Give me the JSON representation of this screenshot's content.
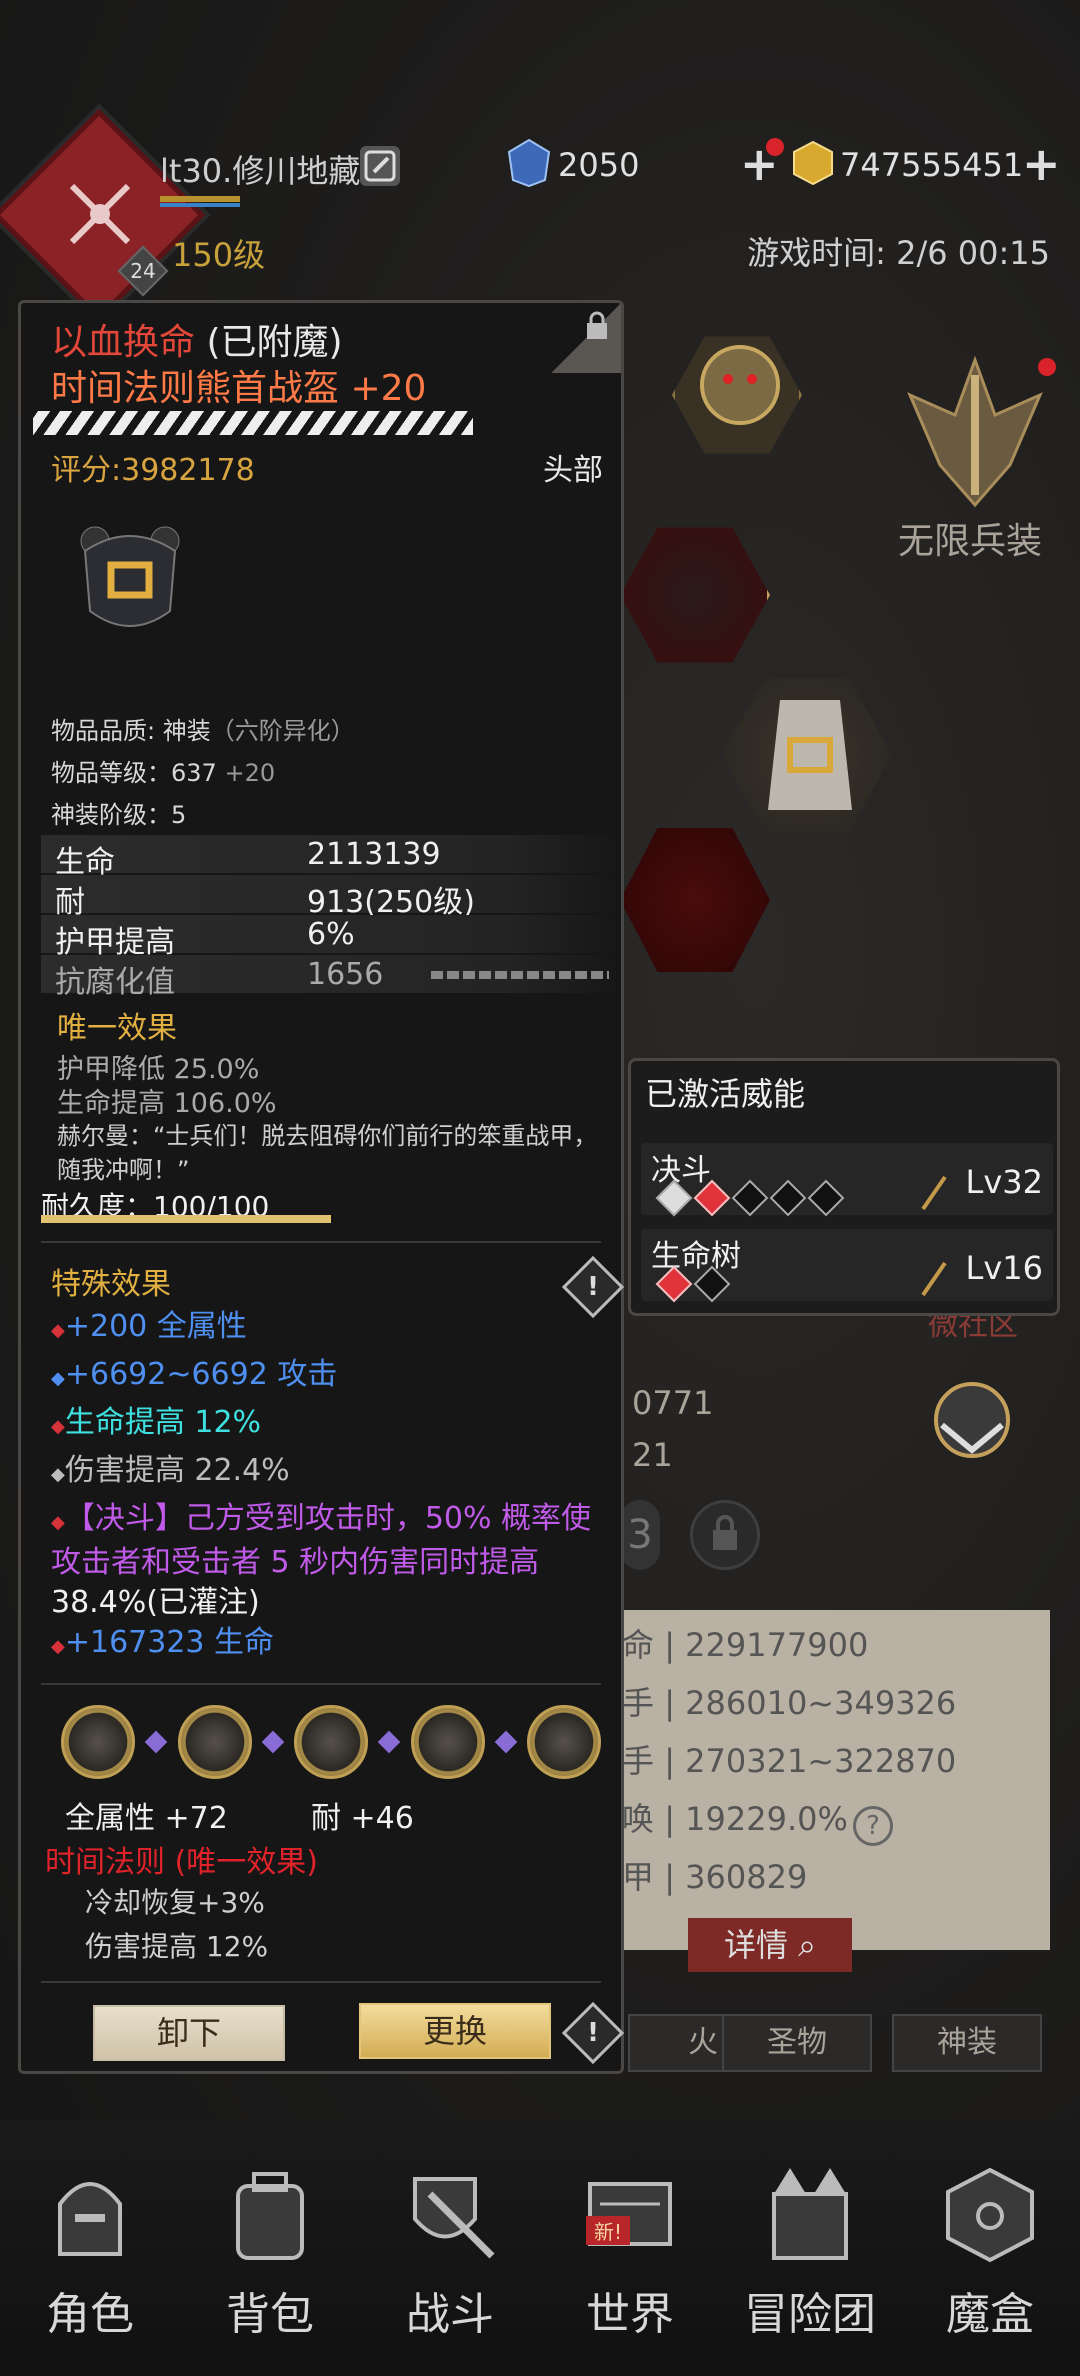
{
  "header": {
    "player_name": "lt30.修川地藏",
    "level": "150级",
    "badge": "24",
    "currency_blue": "2050",
    "currency_gold": "747555451",
    "game_time": "游戏时间: 2/6 00:15"
  },
  "item": {
    "name_prefix": "以血换命",
    "enchanted": " (已附魔)",
    "name": "时间法则熊首战盔 +20",
    "score": "评分:3982178",
    "slot": "头部",
    "quality_label": "物品品质: 神装",
    "quality_sub": "（六阶异化）",
    "item_level_label": "物品等级：637",
    "item_level_bonus": "+20",
    "divine_tier": "神装阶级：5",
    "stats": [
      {
        "name": "生命",
        "value": "2113139"
      },
      {
        "name": "耐",
        "value": "913(250级)"
      },
      {
        "name": "护甲提高",
        "value": "6%"
      },
      {
        "name": "抗腐化值",
        "value": "1656"
      }
    ],
    "unique_title": "唯一效果",
    "unique_lines": [
      "护甲降低 25.0%",
      "生命提高 106.0%"
    ],
    "quote": "赫尔曼：“士兵们！脱去阻碍你们前行的笨重战甲，随我冲啊！”",
    "durability_label": "耐久度：",
    "durability_value": "100/100",
    "durability_fraction": 1.0,
    "special_title": "特殊效果",
    "effects": [
      {
        "text": "+200 全属性",
        "color": "#4f8ff0"
      },
      {
        "text": "+6692~6692 攻击",
        "color": "#4f8ff0"
      },
      {
        "text": "生命提高 12%",
        "color": "#3fe0e0"
      },
      {
        "text": "伤害提高 22.4%",
        "color": "#bdbdbd"
      }
    ],
    "duel_effect_a": "【决斗】己方受到攻击时，50% 概率使攻击者和受击者 5 秒内伤害同时提高",
    "duel_effect_b": " 38.4%(已灌注)",
    "life_bonus": "+167323 生命",
    "socket_stat_1": "全属性  +72",
    "socket_stat_2": "耐  +46",
    "set_title": "时间法则 (唯一效果)",
    "set_lines": [
      "冷却恢复+3%",
      "伤害提高 12%"
    ],
    "btn_unequip": "卸下",
    "btn_replace": "更换"
  },
  "right": {
    "infinite_arms": "无限兵装",
    "weineng_title": "已激活威能",
    "weineng": [
      {
        "name": "决斗",
        "level": "Lv32"
      },
      {
        "name": "生命树",
        "level": "Lv16"
      }
    ],
    "partial_1": "0771",
    "partial_2": "21",
    "partial_3": "3",
    "stats": [
      {
        "k": "命",
        "v": "229177900"
      },
      {
        "k": "手",
        "v": "286010~349326"
      },
      {
        "k": "手",
        "v": "270321~322870"
      },
      {
        "k": "唤",
        "v": "19229.0%"
      },
      {
        "k": "甲",
        "v": "360829"
      }
    ],
    "detail_btn": "详情",
    "tab_fire": "火",
    "tab_relic": "圣物",
    "tab_divine": "神装",
    "new_badge": "新!"
  },
  "nav": [
    {
      "label": "角色"
    },
    {
      "label": "背包"
    },
    {
      "label": "战斗"
    },
    {
      "label": "世界"
    },
    {
      "label": "冒险团"
    },
    {
      "label": "魔盒"
    }
  ],
  "colors": {
    "accent_gold": "#d8a440",
    "item_red": "#e3473a",
    "effect_blue": "#4f8ff0",
    "effect_purple": "#c05ae8"
  }
}
